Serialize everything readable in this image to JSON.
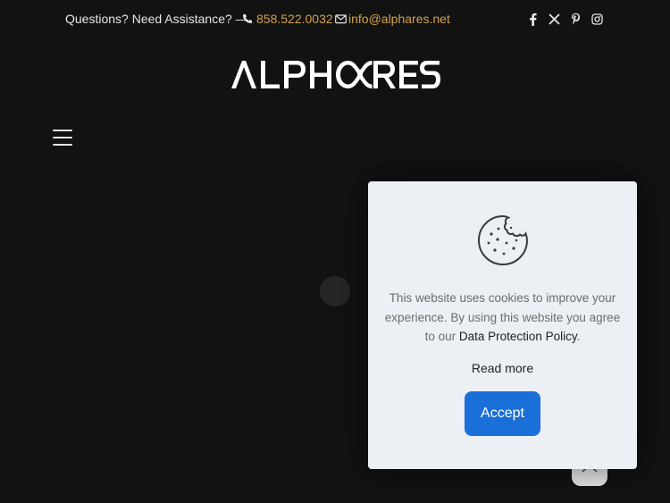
{
  "topbar": {
    "question": "Questions? Need Assistance? —",
    "phone": "858.522.0032",
    "email": "info@alphares.net",
    "socials": [
      "facebook-icon",
      "x-twitter-icon",
      "pinterest-icon",
      "instagram-icon"
    ]
  },
  "logo": {
    "text": "ALPHORES"
  },
  "menu": {
    "icon": "hamburger-menu-icon"
  },
  "cookie": {
    "icon": "cookie-icon",
    "message": "This website uses cookies to improve your experience. By using this website you agree to our",
    "policy_link": "Data Protection Policy",
    "period": ".",
    "read_more": "Read more",
    "accept": "Accept"
  },
  "scroll_top": {
    "icon": "chevron-up-icon"
  },
  "colors": {
    "background": "#121212",
    "accent_gold": "#d4a24c",
    "accept_blue": "#1a6fd9",
    "panel": "#eceff3"
  }
}
